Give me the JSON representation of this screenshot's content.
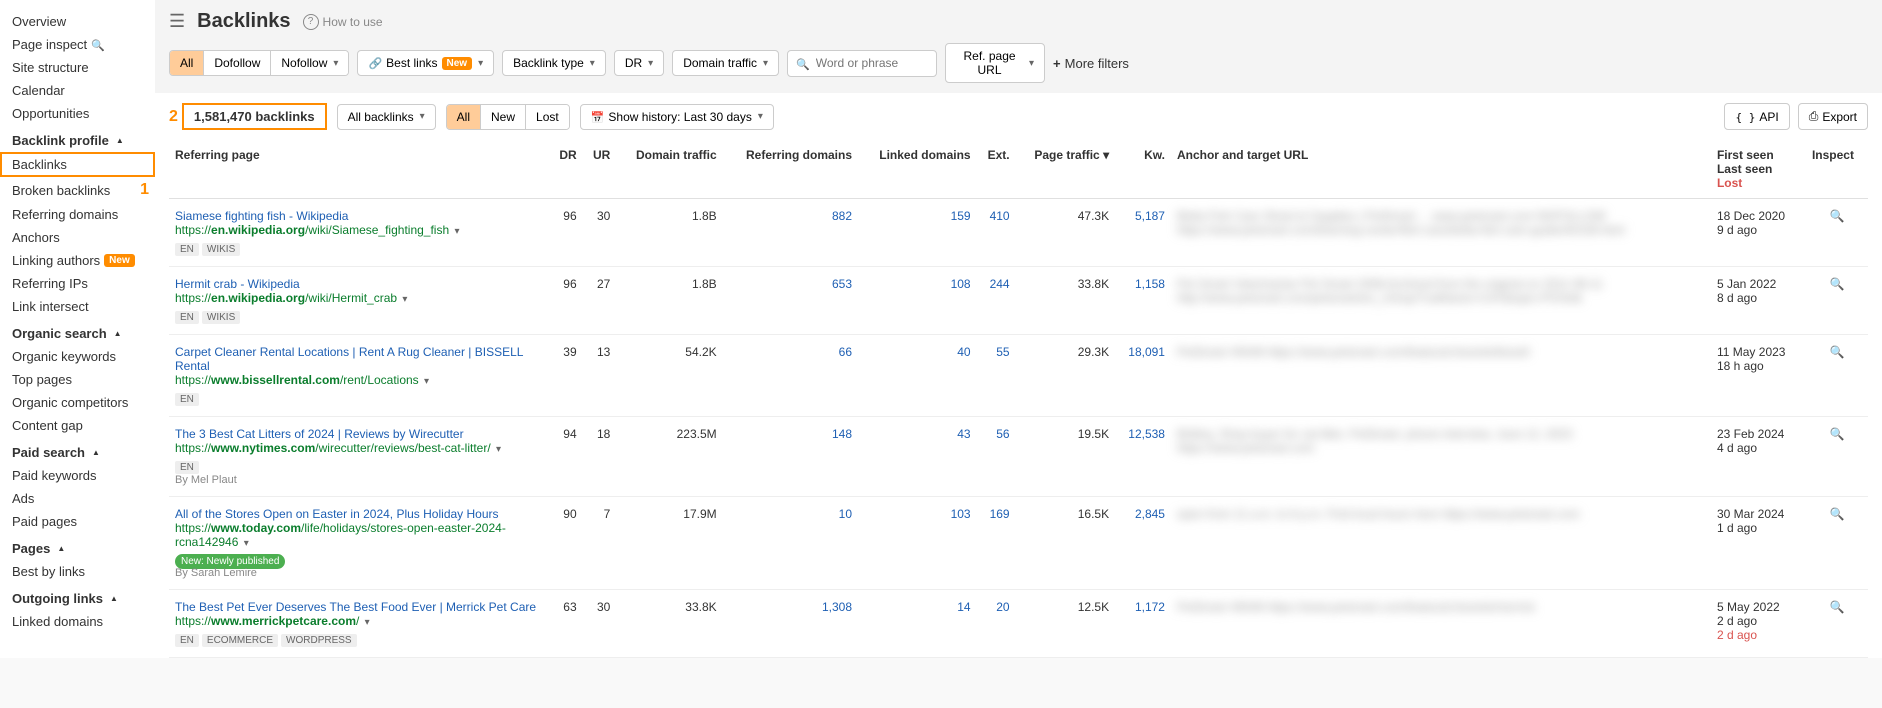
{
  "sidebar": {
    "overview": "Overview",
    "page_inspect": "Page inspect",
    "site_structure": "Site structure",
    "calendar": "Calendar",
    "opportunities": "Opportunities",
    "backlink_profile": "Backlink profile",
    "backlinks": "Backlinks",
    "broken_backlinks": "Broken backlinks",
    "referring_domains": "Referring domains",
    "anchors": "Anchors",
    "linking_authors": "Linking authors",
    "referring_ips": "Referring IPs",
    "link_intersect": "Link intersect",
    "organic_search": "Organic search",
    "organic_keywords": "Organic keywords",
    "top_pages": "Top pages",
    "organic_competitors": "Organic competitors",
    "content_gap": "Content gap",
    "paid_search": "Paid search",
    "paid_keywords": "Paid keywords",
    "ads": "Ads",
    "paid_pages": "Paid pages",
    "pages": "Pages",
    "best_by_links": "Best by links",
    "outgoing_links": "Outgoing links",
    "linked_domains": "Linked domains",
    "new_label": "New"
  },
  "header": {
    "title": "Backlinks",
    "how_to_use": "How to use"
  },
  "filters": {
    "all": "All",
    "dofollow": "Dofollow",
    "nofollow": "Nofollow",
    "best_links": "Best links",
    "backlink_type": "Backlink type",
    "dr": "DR",
    "domain_traffic": "Domain traffic",
    "search_placeholder": "Word or phrase",
    "ref_page_url": "Ref. page URL",
    "more_filters": "More filters"
  },
  "toolbar": {
    "annotation_2": "2",
    "annotation_1": "1",
    "count": "1,581,470 backlinks",
    "all_backlinks": "All backlinks",
    "all": "All",
    "new": "New",
    "lost": "Lost",
    "show_history": "Show history: Last 30 days",
    "api": "API",
    "export": "Export"
  },
  "columns": {
    "referring_page": "Referring page",
    "dr": "DR",
    "ur": "UR",
    "domain_traffic": "Domain traffic",
    "referring_domains": "Referring domains",
    "linked_domains": "Linked domains",
    "ext": "Ext.",
    "page_traffic": "Page traffic",
    "kw": "Kw.",
    "anchor": "Anchor and target URL",
    "first_seen": "First seen",
    "last_seen": "Last seen",
    "lost": "Lost",
    "inspect": "Inspect"
  },
  "rows": [
    {
      "title": "Siamese fighting fish - Wikipedia",
      "url_prefix": "https://",
      "url_bold": "en.wikipedia.org",
      "url_rest": "/wiki/Siamese_fighting_fish",
      "tags": [
        "EN",
        "WIKIS"
      ],
      "dr": "96",
      "ur": "30",
      "domain_traffic": "1.8B",
      "ref_domains": "882",
      "linked_domains": "159",
      "ext": "410",
      "page_traffic": "47.3K",
      "kw": "5,187",
      "anchor_blur": "Betta Fish Care Sheet & Supplies | PetSmart ... www.petsmart.com NOFOLLOW https://www.petsmart.com/learning-center/fish-care/betta-fish-care-guide/A0106.html",
      "first_seen": "18 Dec 2020",
      "last_seen": "9 d ago"
    },
    {
      "title": "Hermit crab - Wikipedia",
      "url_prefix": "https://",
      "url_bold": "en.wikipedia.org",
      "url_rest": "/wiki/Hermit_crab",
      "tags": [
        "EN",
        "WIKIS"
      ],
      "dr": "96",
      "ur": "27",
      "domain_traffic": "1.8B",
      "ref_domains": "653",
      "linked_domains": "108",
      "ext": "244",
      "page_traffic": "33.8K",
      "kw": "1,158",
      "anchor_blur": "Pet Smart Veterinarian Pet Smart 2008 Archived from the original on 2011-08-11 http://www.petsmart.com/petsmart/en_US/sp/?catName=CAT&topic=PSVetk",
      "first_seen": "5 Jan 2022",
      "last_seen": "8 d ago"
    },
    {
      "title": "Carpet Cleaner Rental Locations | Rent A Rug Cleaner | BISSELL Rental",
      "url_prefix": "https://",
      "url_bold": "www.bissellrental.com",
      "url_rest": "/rent/Locations",
      "tags": [
        "EN"
      ],
      "dr": "39",
      "ur": "13",
      "domain_traffic": "54.2K",
      "ref_domains": "66",
      "linked_domains": "40",
      "ext": "55",
      "page_traffic": "29.3K",
      "kw": "18,091",
      "anchor_blur": "PetSmart #5048 https://www.petsmart.com/featured-brands/bissell",
      "first_seen": "11 May 2023",
      "last_seen": "18 h ago"
    },
    {
      "title": "The 3 Best Cat Litters of 2024 | Reviews by Wirecutter",
      "url_prefix": "https://",
      "url_bold": "www.nytimes.com",
      "url_rest": "/wirecutter/reviews/best-cat-litter/",
      "tags": [
        "EN"
      ],
      "byline": "By Mel Plaut",
      "dr": "94",
      "ur": "18",
      "domain_traffic": "223.5M",
      "ref_domains": "148",
      "linked_domains": "43",
      "ext": "56",
      "page_traffic": "19.5K",
      "kw": "12,538",
      "anchor_blur": "Brittiny, Shop buyer for cat litter, PetSmart, phone interview, June 12, 2023 https://www.petsmart.com",
      "first_seen": "23 Feb 2024",
      "last_seen": "4 d ago"
    },
    {
      "title": "All of the Stores Open on Easter in 2024, Plus Holiday Hours",
      "url_prefix": "https://",
      "url_bold": "www.today.com",
      "url_rest": "/life/holidays/stores-open-easter-2024-rcna142946",
      "tags": [],
      "green_tag": "New: Newly published",
      "byline": "By Sarah Lemire",
      "dr": "90",
      "ur": "7",
      "domain_traffic": "17.9M",
      "ref_domains": "10",
      "linked_domains": "103",
      "ext": "169",
      "page_traffic": "16.5K",
      "kw": "2,845",
      "anchor_blur": "open from 11 a.m. to 6 p.m. Find local hours here https://www.petsmart.com",
      "first_seen": "30 Mar 2024",
      "last_seen": "1 d ago"
    },
    {
      "title": "The Best Pet Ever Deserves The Best Food Ever | Merrick Pet Care",
      "url_prefix": "https://",
      "url_bold": "www.merrickpetcare.com",
      "url_rest": "/",
      "tags": [
        "EN",
        "ECOMMERCE",
        "WORDPRESS"
      ],
      "dr": "63",
      "ur": "30",
      "domain_traffic": "33.8K",
      "ref_domains": "1,308",
      "linked_domains": "14",
      "ext": "20",
      "page_traffic": "12.5K",
      "kw": "1,172",
      "anchor_blur": "PetSmart #6048 https://www.petsmart.com/featured-brands/merrick",
      "first_seen": "5 May 2022",
      "last_seen": "2 d ago",
      "lost": "2 d ago"
    }
  ]
}
